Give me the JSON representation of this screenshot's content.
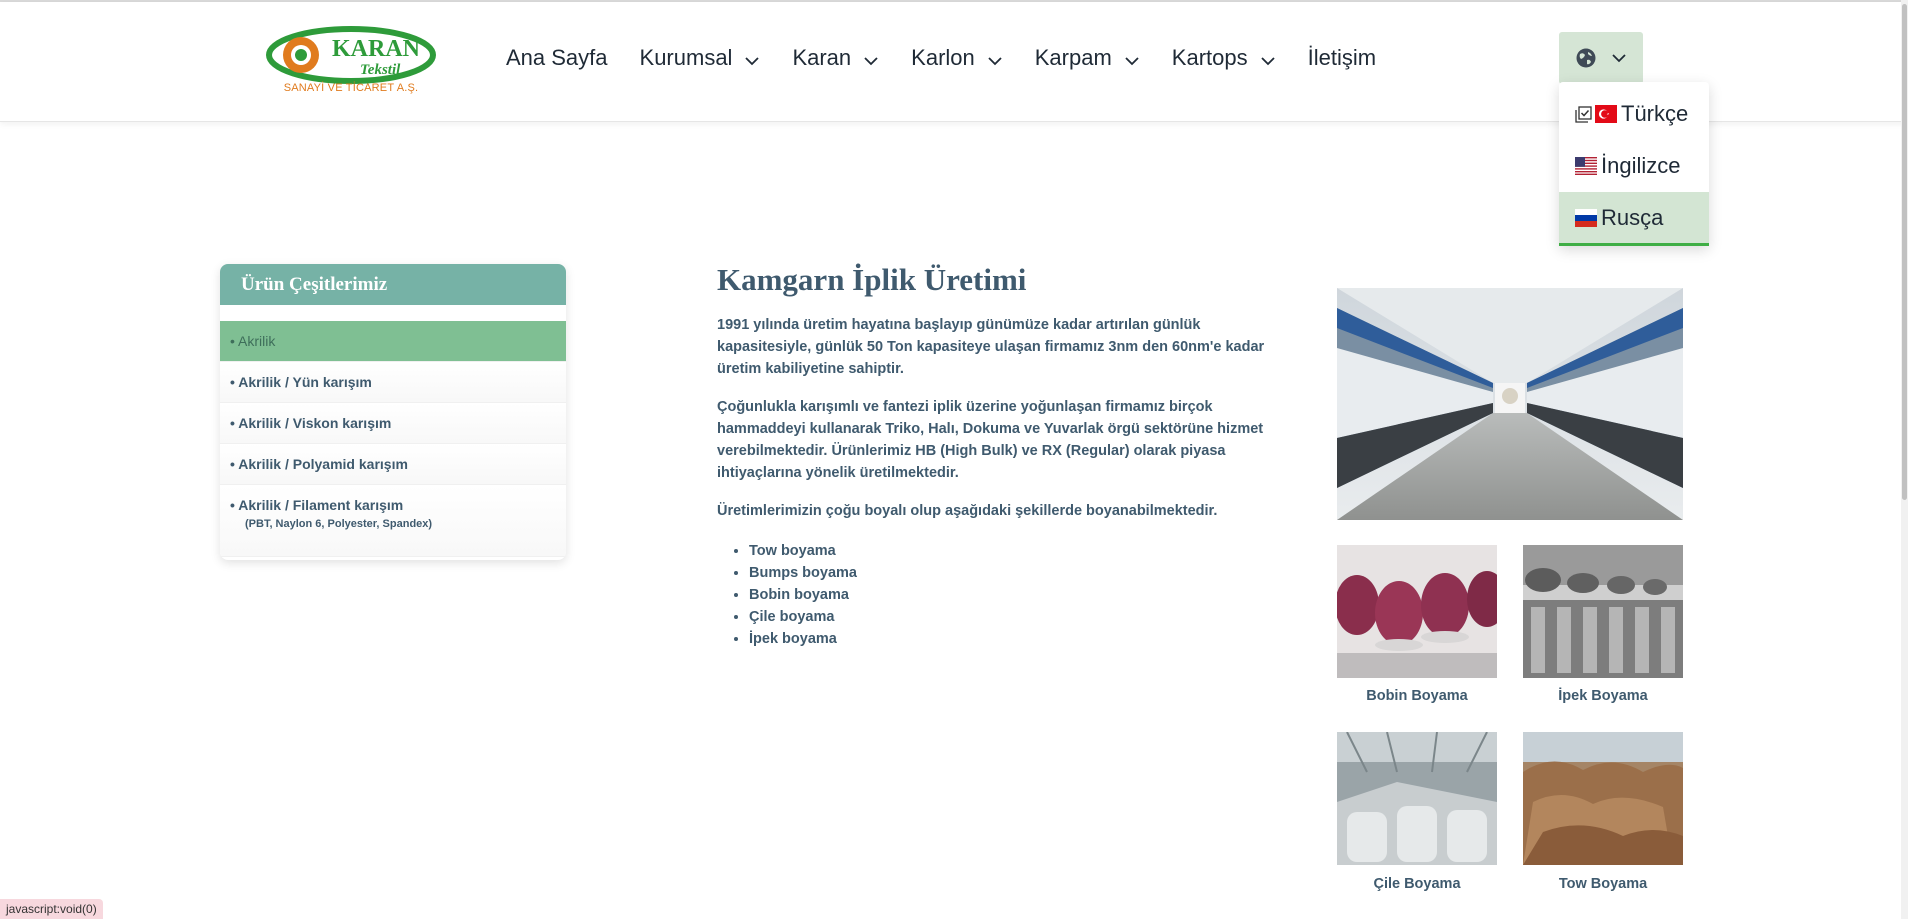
{
  "header": {
    "logo": {
      "brand": "KARAN",
      "script": "Tekstil",
      "subtitle": "SANAYİ VE TİCARET A.Ş."
    },
    "nav": [
      {
        "label": "Ana Sayfa",
        "dropdown": false
      },
      {
        "label": "Kurumsal",
        "dropdown": true
      },
      {
        "label": "Karan",
        "dropdown": true
      },
      {
        "label": "Karlon",
        "dropdown": true
      },
      {
        "label": "Karpam",
        "dropdown": true
      },
      {
        "label": "Kartops",
        "dropdown": true
      },
      {
        "label": "İletişim",
        "dropdown": false
      }
    ],
    "language_button": {
      "icon": "globe-icon",
      "chevron": "chevron-down-icon"
    },
    "language_menu": [
      {
        "label": "Türkçe",
        "flag": "tr-flag",
        "checked": true
      },
      {
        "label": "İngilizce",
        "flag": "us-flag"
      },
      {
        "label": "Rusça",
        "flag": "ru-flag",
        "highlighted": true
      }
    ]
  },
  "sidebar": {
    "title": "Ürün Çeşitlerimiz",
    "items": [
      {
        "label": "• Akrilik",
        "active": true
      },
      {
        "label": "• Akrilik / Yün karışım"
      },
      {
        "label": "• Akrilik / Viskon karışım"
      },
      {
        "label": "• Akrilik / Polyamid karışım"
      },
      {
        "label": "• Akrilik / Filament karışım",
        "note": "(PBT, Naylon 6, Polyester, Spandex)"
      }
    ]
  },
  "main": {
    "title": "Kamgarn İplik Üretimi",
    "paragraphs": [
      "1991 yılında üretim hayatına başlayıp günümüze kadar artırılan günlük kapasitesiyle, günlük 50 Ton kapasiteye ulaşan firmamız 3nm den 60nm'e kadar üretim kabiliyetine sahiptir.",
      "Çoğunlukla karışımlı ve fantezi iplik üzerine yoğunlaşan firmamız birçok hammaddeyi kullanarak Triko, Halı, Dokuma ve Yuvarlak örgü sektörüne hizmet verebilmektedir. Ürünlerimiz HB (High Bulk) ve RX (Regular) olarak piyasa ihtiyaçlarına yönelik üretilmektedir.",
      "Üretimlerimizin çoğu boyalı olup aşağıdaki şekillerde boyanabilmektedir."
    ],
    "bullets": [
      "Tow boyama",
      "Bumps boyama",
      "Bobin boyama",
      "Çile boyama",
      "İpek boyama"
    ]
  },
  "gallery": {
    "captions": [
      "Bobin Boyama",
      "İpek Boyama",
      "Çile Boyama",
      "Tow Boyama"
    ]
  },
  "status_bar": {
    "text": "javascript:void(0)"
  },
  "colors": {
    "accent_green": "#76b2a6",
    "active_green": "#7fbf93",
    "lang_button_bg": "#d5e5d5",
    "text_slate": "#3f5a6e",
    "logo_orange": "#e07b1e",
    "logo_green": "#2e9b3a"
  }
}
